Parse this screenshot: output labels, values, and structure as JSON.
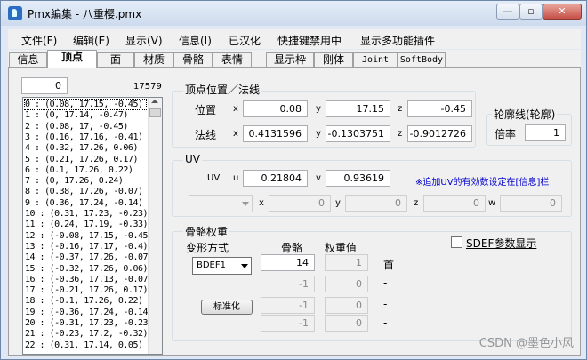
{
  "window": {
    "title": "Pmx編集 - 八重樱.pmx",
    "btn_min": "—",
    "btn_max": "▫",
    "btn_close": "✕"
  },
  "menu": [
    "文件(F)",
    "编辑(E)",
    "显示(V)",
    "信息(I)",
    "已汉化",
    "快捷键禁用中",
    "显示多功能插件"
  ],
  "tabs": [
    "信息",
    "顶点",
    "面",
    "材质",
    "骨骼",
    "表情",
    "显示枠",
    "刚体",
    "Joint",
    "SoftBody"
  ],
  "active_tab": "顶点",
  "search_value": "0",
  "vertex_count": "17579",
  "vertex_list": [
    "0 : (0.08, 17.15, -0.45)",
    "1 : (0, 17.14, -0.47)",
    "2 : (0.08, 17, -0.45)",
    "3 : (0.16, 17.16, -0.41)",
    "4 : (0.32, 17.26, 0.06)",
    "5 : (0.21, 17.26, 0.17)",
    "6 : (0.1, 17.26, 0.22)",
    "7 : (0, 17.26, 0.24)",
    "8 : (0.38, 17.26, -0.07)",
    "9 : (0.36, 17.24, -0.14)",
    "10 : (0.31, 17.23, -0.23)",
    "11 : (0.24, 17.19, -0.33)",
    "12 : (-0.08, 17.15, -0.45)",
    "13 : (-0.16, 17.17, -0.4)",
    "14 : (-0.37, 17.26, -0.07)",
    "15 : (-0.32, 17.26, 0.06)",
    "16 : (-0.36, 17.13, -0.07)",
    "17 : (-0.21, 17.26, 0.17)",
    "18 : (-0.1, 17.26, 0.22)",
    "19 : (-0.36, 17.24, -0.14)",
    "20 : (-0.31, 17.23, -0.23)",
    "21 : (-0.23, 17.2, -0.32)",
    "22 : (0.31, 17.14, 0.05)"
  ],
  "pos": {
    "heading": "顶点位置／法线",
    "pos_label": "位置",
    "x_label": "x",
    "y_label": "y",
    "z_label": "z",
    "x": "0.08",
    "y": "17.15",
    "z": "-0.45",
    "normal_label": "法线",
    "nx": "0.4131596",
    "ny": "-0.1303751",
    "nz": "-0.9012726"
  },
  "outline": {
    "heading": "轮廓线(轮廓)",
    "rate_label": "倍率",
    "rate": "1"
  },
  "uv": {
    "heading": "UV",
    "uv_label": "UV",
    "u_label": "u",
    "v_label": "v",
    "u": "0.21804",
    "v": "0.93619",
    "note": "※追加UV的有効数设定在[信息]栏",
    "ex_x": "0",
    "ex_y": "0",
    "ex_z": "0",
    "ex_w": "0",
    "lx": "x",
    "ly": "y",
    "lz": "z",
    "lw": "w"
  },
  "weight": {
    "heading": "骨骼权重",
    "deform_label": "变形方式",
    "deform_value": "BDEF1",
    "bone_header": "骨骼",
    "weight_header": "权重值",
    "bones": [
      "14",
      "-1",
      "-1",
      "-1"
    ],
    "weights": [
      "1",
      "0",
      "0",
      "0"
    ],
    "row1_label": "首",
    "dash": "-",
    "normalize_btn": "标准化",
    "sdef_label": "SDEF参数显示"
  },
  "watermark": "CSDN @墨色小风"
}
